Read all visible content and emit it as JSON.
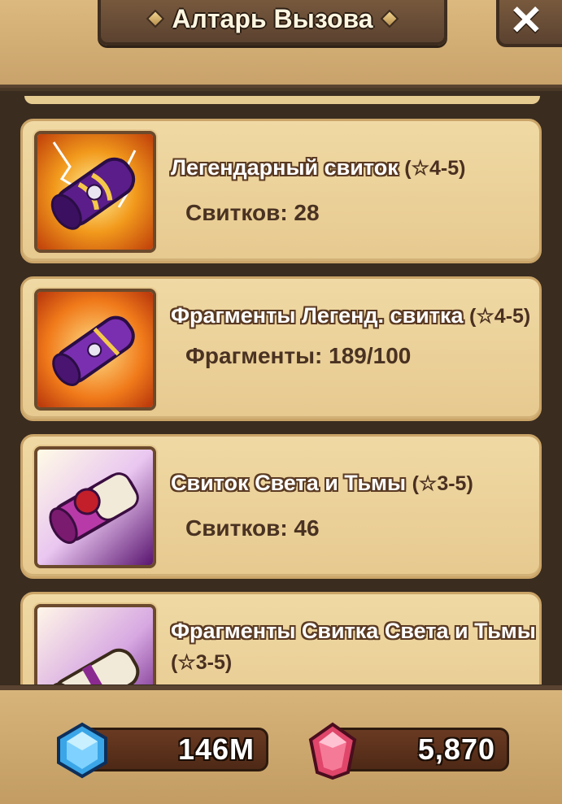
{
  "header": {
    "title": "Алтарь Вызова",
    "close_symbol": "✕"
  },
  "items": [
    {
      "name": "Легендарный свиток",
      "rank": "(☆4-5)",
      "count_label": "Свитков: 28",
      "icon": "legendary-scroll-icon"
    },
    {
      "name": "Фрагменты Легенд. свитка",
      "rank": "(☆4-5)",
      "count_label": "Фрагменты: 189/100",
      "icon": "legendary-scroll-fragment-icon"
    },
    {
      "name": "Свиток Света и Тьмы",
      "rank": "(☆3-5)",
      "count_label": "Свитков: 46",
      "icon": "light-dark-scroll-icon"
    },
    {
      "name": "Фрагменты Свитка Света и Тьмы",
      "rank": "(☆3-5)",
      "count_label": "",
      "icon": "light-dark-scroll-fragment-icon"
    }
  ],
  "resources": {
    "mana": {
      "value": "146M",
      "icon": "mana-crystal-icon",
      "color": "#3aa6e8"
    },
    "crystals": {
      "value": "5,870",
      "icon": "crystal-icon",
      "color": "#e0456a"
    }
  },
  "colors": {
    "card_bg": "#f0d9a4",
    "frame": "#5a4330",
    "title_text": "#fff6e0"
  }
}
